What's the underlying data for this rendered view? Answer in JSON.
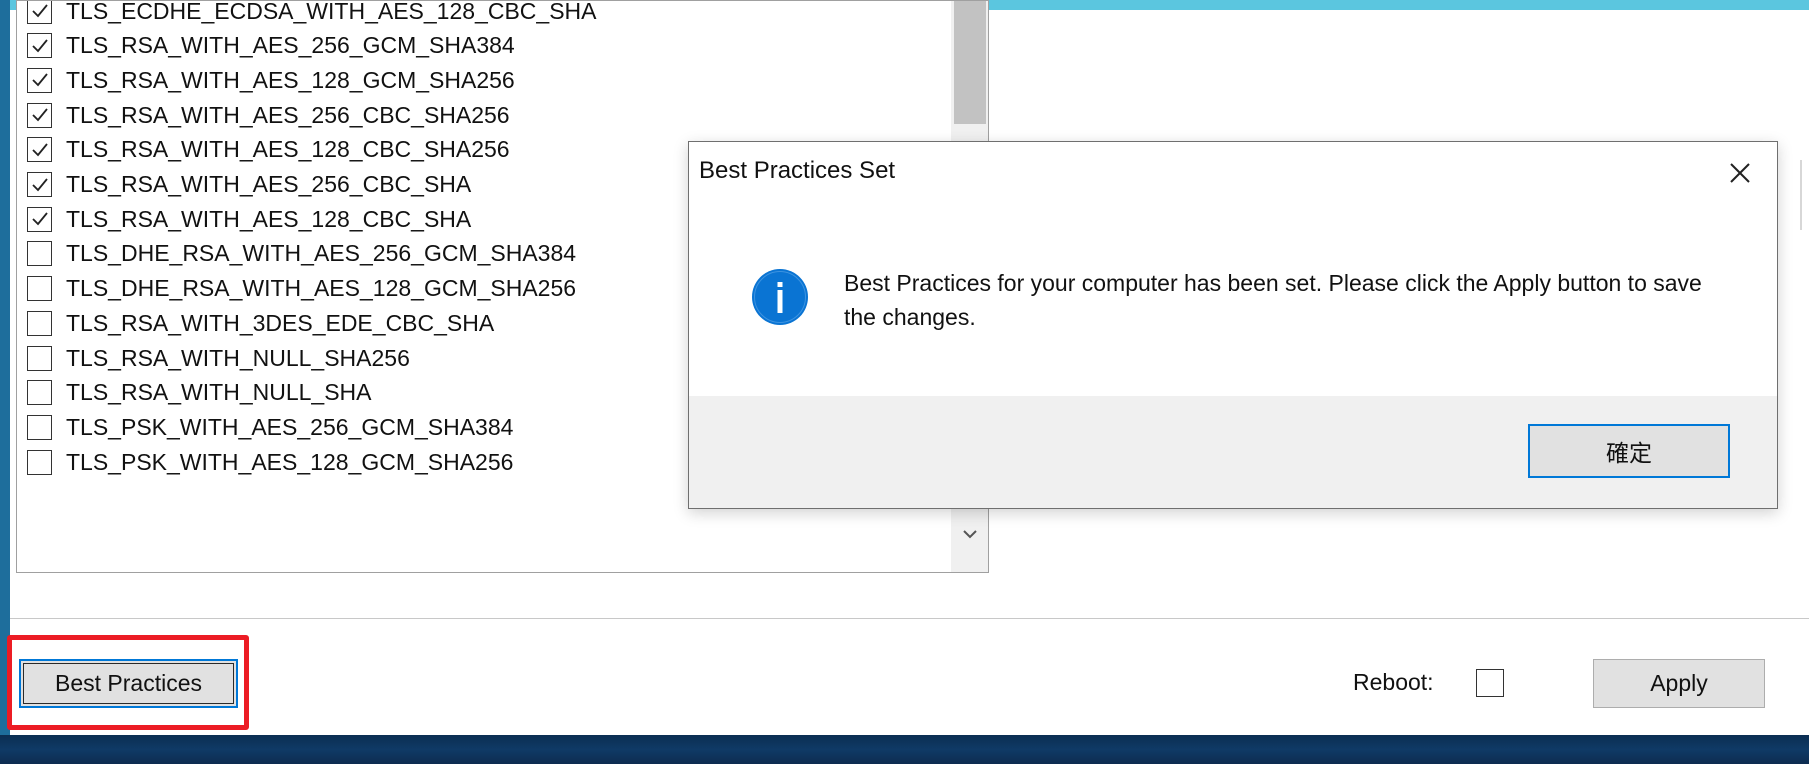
{
  "cipher_suites": [
    {
      "name": "TLS_ECDHE_ECDSA_WITH_AES_128_CBC_SHA",
      "checked": true
    },
    {
      "name": "TLS_RSA_WITH_AES_256_GCM_SHA384",
      "checked": true
    },
    {
      "name": "TLS_RSA_WITH_AES_128_GCM_SHA256",
      "checked": true
    },
    {
      "name": "TLS_RSA_WITH_AES_256_CBC_SHA256",
      "checked": true
    },
    {
      "name": "TLS_RSA_WITH_AES_128_CBC_SHA256",
      "checked": true
    },
    {
      "name": "TLS_RSA_WITH_AES_256_CBC_SHA",
      "checked": true
    },
    {
      "name": "TLS_RSA_WITH_AES_128_CBC_SHA",
      "checked": true
    },
    {
      "name": "TLS_DHE_RSA_WITH_AES_256_GCM_SHA384",
      "checked": false
    },
    {
      "name": "TLS_DHE_RSA_WITH_AES_128_GCM_SHA256",
      "checked": false
    },
    {
      "name": "TLS_RSA_WITH_3DES_EDE_CBC_SHA",
      "checked": false
    },
    {
      "name": "TLS_RSA_WITH_NULL_SHA256",
      "checked": false
    },
    {
      "name": "TLS_RSA_WITH_NULL_SHA",
      "checked": false
    },
    {
      "name": "TLS_PSK_WITH_AES_256_GCM_SHA384",
      "checked": false
    },
    {
      "name": "TLS_PSK_WITH_AES_128_GCM_SHA256",
      "checked": false
    }
  ],
  "footer": {
    "best_practices_label": "Best Practices",
    "reboot_label": "Reboot:",
    "reboot_checked": false,
    "apply_label": "Apply"
  },
  "dialog": {
    "title": "Best Practices Set",
    "message": "Best Practices for your computer has been set. Please click the Apply button to save the changes.",
    "ok_label": "確定",
    "icon": "info-icon"
  },
  "colors": {
    "accent": "#0078d7",
    "highlight": "#ec1c24",
    "info_icon": "#0a74d3"
  }
}
